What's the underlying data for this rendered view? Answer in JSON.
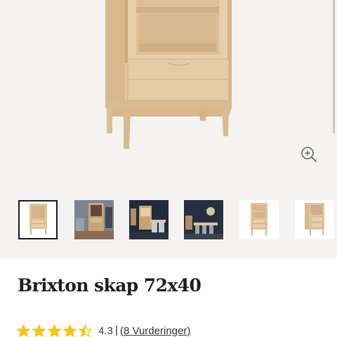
{
  "product": {
    "title": "Brixton skap 72x40",
    "rating": {
      "value": "4.3",
      "separator": "|",
      "reviews_link": "(8 Vurderinger)",
      "stars_filled": 4.3,
      "stars_total": 5
    }
  },
  "gallery": {
    "zoom_icon": "zoom-in-icon",
    "thumbnails_visible": 6,
    "active_thumbnail": 1
  },
  "colors": {
    "star": "#f5c518",
    "gallery_background": "#f4f3f1",
    "title": "#1e1e1e",
    "oak": "#e3c7a0"
  }
}
